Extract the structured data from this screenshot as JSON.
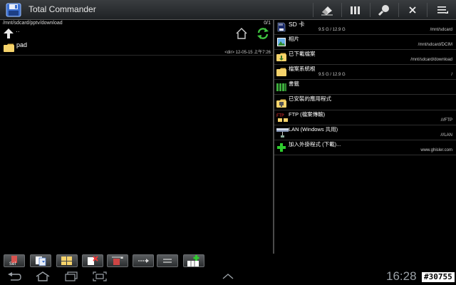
{
  "app": {
    "title": "Total Commander",
    "icon": "floppy-disk-icon"
  },
  "titlebar": {
    "buttons": [
      {
        "icon": "eraser-icon"
      },
      {
        "icon": "columns-icon"
      },
      {
        "icon": "magnifier-icon"
      },
      {
        "icon": "close-icon"
      },
      {
        "icon": "menu-icon"
      }
    ]
  },
  "left_panel": {
    "path": "/mnt/sdcard/pptv/download",
    "count": "0/1",
    "up_label": "..",
    "files": [
      {
        "name": "pad",
        "meta": "<dir>  12-05-15  上午7:26"
      }
    ]
  },
  "right_panel": {
    "locations": [
      {
        "name": "SD 卡",
        "size": "9.5 G / 12.9 G",
        "path": "/mnt/sdcard",
        "icon": "sd-card-icon"
      },
      {
        "name": "相片",
        "size": "",
        "path": "/mnt/sdcard/DCIM",
        "icon": "photo-icon"
      },
      {
        "name": "已下載檔案",
        "size": "",
        "path": "/mnt/sdcard/download",
        "icon": "download-folder-icon"
      },
      {
        "name": "檔案系統根",
        "size": "9.5 G / 12.9 G",
        "path": "/",
        "icon": "folder-icon"
      },
      {
        "name": "書籤",
        "size": "",
        "path": "",
        "icon": "bookmarks-icon"
      },
      {
        "name": "已安裝的應用程式",
        "size": "",
        "path": "",
        "icon": "apps-folder-icon"
      },
      {
        "name": "FTP (檔案傳輸)",
        "size": "",
        "path": "///FTP",
        "icon": "ftp-icon"
      },
      {
        "name": "LAN (Windows 共用)",
        "size": "",
        "path": "///LAN",
        "icon": "lan-icon"
      },
      {
        "name": "加入外掛程式 (下載)...",
        "size": "",
        "path": "www.ghisler.com",
        "icon": "add-plugin-icon"
      }
    ]
  },
  "bottom_toolbar": {
    "buttons": [
      {
        "icon": "select-icon"
      },
      {
        "icon": "copy-icon"
      },
      {
        "icon": "pack-icon"
      },
      {
        "icon": "delete-icon"
      },
      {
        "icon": "sort-icon"
      },
      {
        "icon": "swap-panels-icon"
      },
      {
        "icon": "equal-panels-icon"
      },
      {
        "icon": "new-folder-icon"
      }
    ]
  },
  "system_bar": {
    "clock": "16:28",
    "watermark": "#30755"
  }
}
